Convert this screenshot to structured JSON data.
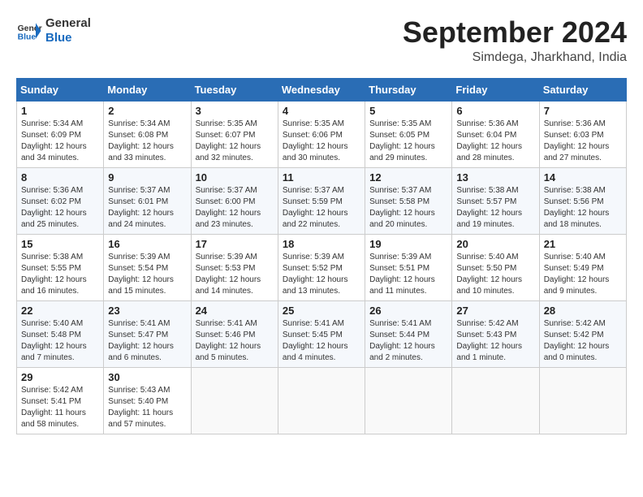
{
  "header": {
    "logo_general": "General",
    "logo_blue": "Blue",
    "month_year": "September 2024",
    "location": "Simdega, Jharkhand, India"
  },
  "days_of_week": [
    "Sunday",
    "Monday",
    "Tuesday",
    "Wednesday",
    "Thursday",
    "Friday",
    "Saturday"
  ],
  "weeks": [
    [
      {
        "day": "1",
        "sunrise": "5:34 AM",
        "sunset": "6:09 PM",
        "daylight": "12 hours and 34 minutes."
      },
      {
        "day": "2",
        "sunrise": "5:34 AM",
        "sunset": "6:08 PM",
        "daylight": "12 hours and 33 minutes."
      },
      {
        "day": "3",
        "sunrise": "5:35 AM",
        "sunset": "6:07 PM",
        "daylight": "12 hours and 32 minutes."
      },
      {
        "day": "4",
        "sunrise": "5:35 AM",
        "sunset": "6:06 PM",
        "daylight": "12 hours and 30 minutes."
      },
      {
        "day": "5",
        "sunrise": "5:35 AM",
        "sunset": "6:05 PM",
        "daylight": "12 hours and 29 minutes."
      },
      {
        "day": "6",
        "sunrise": "5:36 AM",
        "sunset": "6:04 PM",
        "daylight": "12 hours and 28 minutes."
      },
      {
        "day": "7",
        "sunrise": "5:36 AM",
        "sunset": "6:03 PM",
        "daylight": "12 hours and 27 minutes."
      }
    ],
    [
      {
        "day": "8",
        "sunrise": "5:36 AM",
        "sunset": "6:02 PM",
        "daylight": "12 hours and 25 minutes."
      },
      {
        "day": "9",
        "sunrise": "5:37 AM",
        "sunset": "6:01 PM",
        "daylight": "12 hours and 24 minutes."
      },
      {
        "day": "10",
        "sunrise": "5:37 AM",
        "sunset": "6:00 PM",
        "daylight": "12 hours and 23 minutes."
      },
      {
        "day": "11",
        "sunrise": "5:37 AM",
        "sunset": "5:59 PM",
        "daylight": "12 hours and 22 minutes."
      },
      {
        "day": "12",
        "sunrise": "5:37 AM",
        "sunset": "5:58 PM",
        "daylight": "12 hours and 20 minutes."
      },
      {
        "day": "13",
        "sunrise": "5:38 AM",
        "sunset": "5:57 PM",
        "daylight": "12 hours and 19 minutes."
      },
      {
        "day": "14",
        "sunrise": "5:38 AM",
        "sunset": "5:56 PM",
        "daylight": "12 hours and 18 minutes."
      }
    ],
    [
      {
        "day": "15",
        "sunrise": "5:38 AM",
        "sunset": "5:55 PM",
        "daylight": "12 hours and 16 minutes."
      },
      {
        "day": "16",
        "sunrise": "5:39 AM",
        "sunset": "5:54 PM",
        "daylight": "12 hours and 15 minutes."
      },
      {
        "day": "17",
        "sunrise": "5:39 AM",
        "sunset": "5:53 PM",
        "daylight": "12 hours and 14 minutes."
      },
      {
        "day": "18",
        "sunrise": "5:39 AM",
        "sunset": "5:52 PM",
        "daylight": "12 hours and 13 minutes."
      },
      {
        "day": "19",
        "sunrise": "5:39 AM",
        "sunset": "5:51 PM",
        "daylight": "12 hours and 11 minutes."
      },
      {
        "day": "20",
        "sunrise": "5:40 AM",
        "sunset": "5:50 PM",
        "daylight": "12 hours and 10 minutes."
      },
      {
        "day": "21",
        "sunrise": "5:40 AM",
        "sunset": "5:49 PM",
        "daylight": "12 hours and 9 minutes."
      }
    ],
    [
      {
        "day": "22",
        "sunrise": "5:40 AM",
        "sunset": "5:48 PM",
        "daylight": "12 hours and 7 minutes."
      },
      {
        "day": "23",
        "sunrise": "5:41 AM",
        "sunset": "5:47 PM",
        "daylight": "12 hours and 6 minutes."
      },
      {
        "day": "24",
        "sunrise": "5:41 AM",
        "sunset": "5:46 PM",
        "daylight": "12 hours and 5 minutes."
      },
      {
        "day": "25",
        "sunrise": "5:41 AM",
        "sunset": "5:45 PM",
        "daylight": "12 hours and 4 minutes."
      },
      {
        "day": "26",
        "sunrise": "5:41 AM",
        "sunset": "5:44 PM",
        "daylight": "12 hours and 2 minutes."
      },
      {
        "day": "27",
        "sunrise": "5:42 AM",
        "sunset": "5:43 PM",
        "daylight": "12 hours and 1 minute."
      },
      {
        "day": "28",
        "sunrise": "5:42 AM",
        "sunset": "5:42 PM",
        "daylight": "12 hours and 0 minutes."
      }
    ],
    [
      {
        "day": "29",
        "sunrise": "5:42 AM",
        "sunset": "5:41 PM",
        "daylight": "11 hours and 58 minutes."
      },
      {
        "day": "30",
        "sunrise": "5:43 AM",
        "sunset": "5:40 PM",
        "daylight": "11 hours and 57 minutes."
      },
      null,
      null,
      null,
      null,
      null
    ]
  ]
}
